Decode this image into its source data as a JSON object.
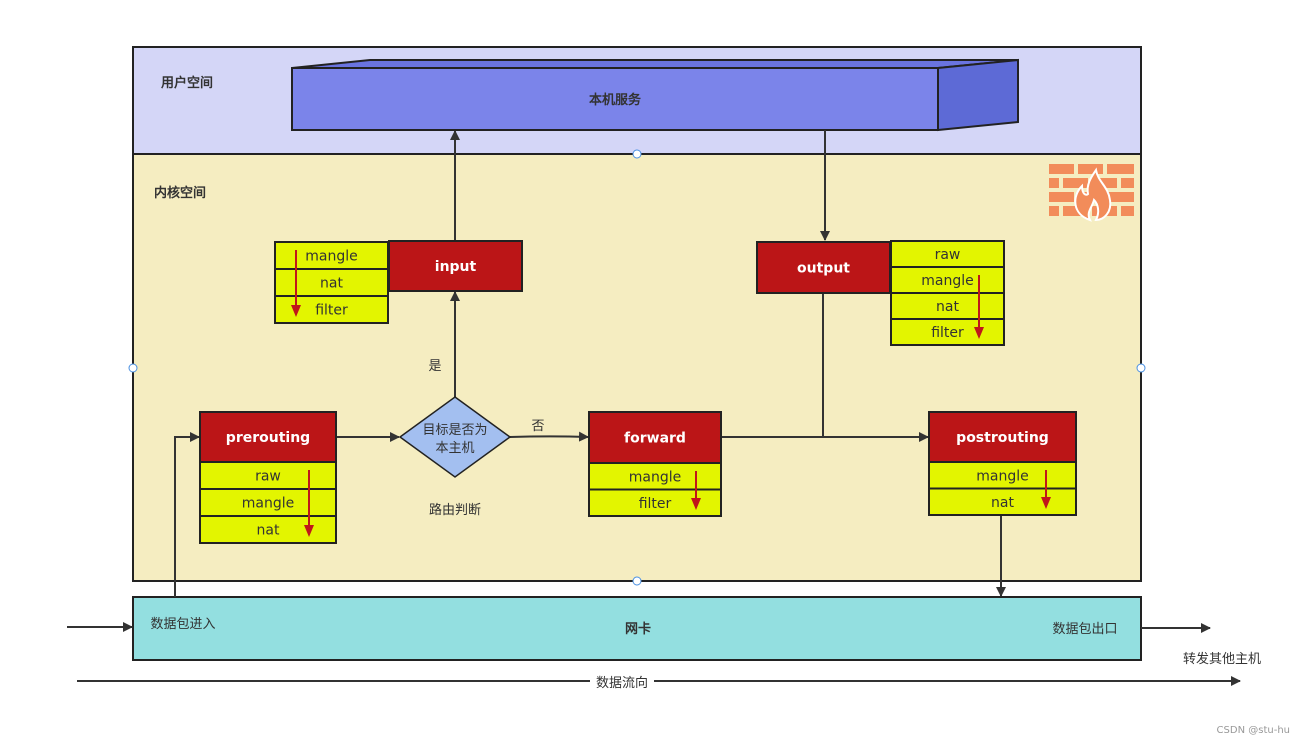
{
  "colors": {
    "user_space": "#d4d6f7",
    "kernel_space": "#f5edc1",
    "nic": "#93dfe0",
    "service": "#7b84ea",
    "chain": "#bb1517",
    "table": "#e3f500",
    "decision": "#a3bff0",
    "firewall": "#f28c5a",
    "order_arrow": "#c0161a"
  },
  "regions": {
    "user_space": "用户空间",
    "kernel_space": "内核空间",
    "nic": "网卡"
  },
  "service": "本机服务",
  "firewall_icon": "firewall-icon",
  "chains": {
    "input": {
      "label": "input",
      "tables": [
        "mangle",
        "nat",
        "filter"
      ]
    },
    "output": {
      "label": "output",
      "tables": [
        "raw",
        "mangle",
        "nat",
        "filter"
      ]
    },
    "prerouting": {
      "label": "prerouting",
      "tables": [
        "raw",
        "mangle",
        "nat"
      ]
    },
    "forward": {
      "label": "forward",
      "tables": [
        "mangle",
        "filter"
      ]
    },
    "postrouting": {
      "label": "postrouting",
      "tables": [
        "mangle",
        "nat"
      ]
    }
  },
  "decision": {
    "line1": "目标是否为",
    "line2": "本主机",
    "yes": "是",
    "no": "否",
    "caption": "路由判断"
  },
  "packets": {
    "in": "数据包进入",
    "out": "数据包出口",
    "forward_other": "转发其他主机",
    "flow": "数据流向"
  },
  "watermark": "CSDN @stu-hu"
}
